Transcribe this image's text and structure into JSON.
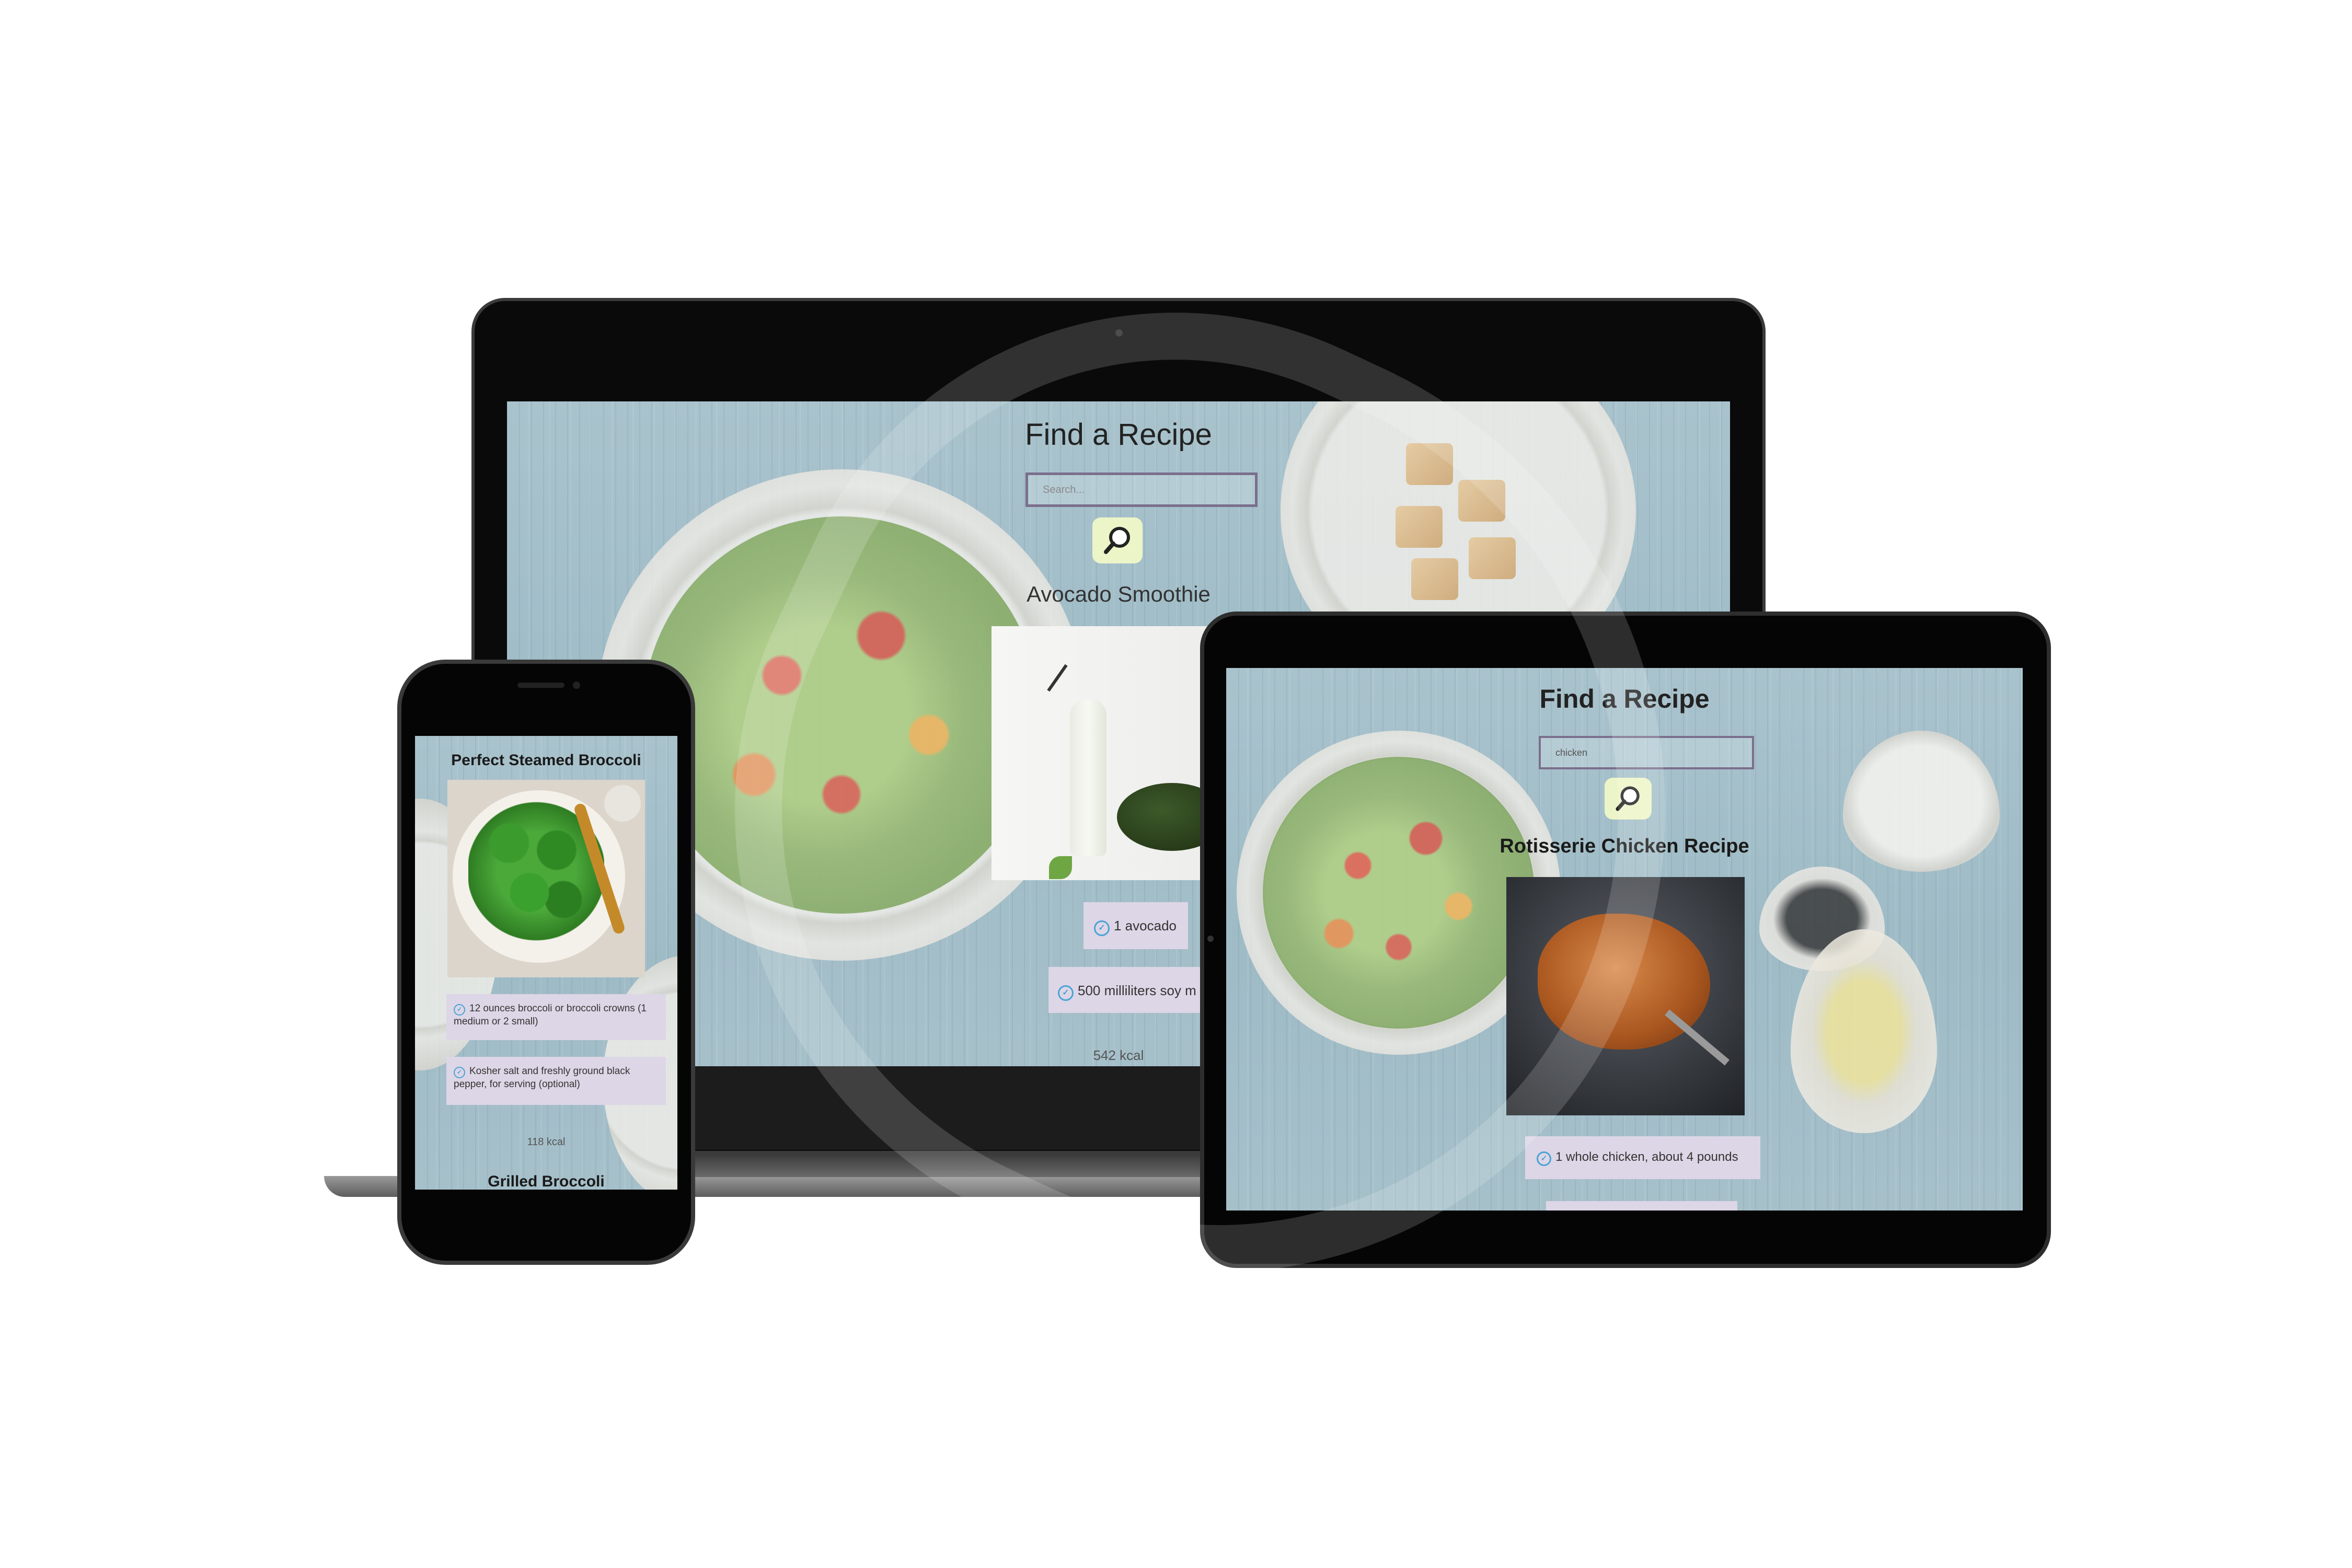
{
  "laptop": {
    "app_title": "Find a Recipe",
    "search": {
      "value": "",
      "placeholder": "Search..."
    },
    "search_icon": "magnifier-icon",
    "recipe": {
      "name": "Avocado Smoothie",
      "ingredients": [
        "1 avocado",
        "500 milliliters soy m"
      ],
      "calories": "542 kcal"
    }
  },
  "tablet": {
    "app_title": "Find a Recipe",
    "search": {
      "value": "chicken",
      "placeholder": ""
    },
    "search_icon": "magnifier-icon",
    "recipe": {
      "name": "Rotisserie Chicken Recipe",
      "ingredients": [
        "1 whole chicken, about 4 pounds"
      ]
    }
  },
  "phone": {
    "recipe": {
      "name": "Perfect Steamed Broccoli",
      "ingredients": [
        "12 ounces broccoli or broccoli crowns (1 medium or 2 small)",
        "Kosher salt and freshly ground black pepper, for serving (optional)"
      ],
      "calories": "118 kcal"
    },
    "next_recipe": {
      "name": "Grilled Broccoli"
    }
  },
  "colors": {
    "background": "#ffffff",
    "device_bezel": "#050505",
    "screen_wood": "#a3bec8",
    "search_border": "#7a6f8c",
    "search_button": "#ecf5c8",
    "ingredient_chip": "#ddd6e6",
    "check_icon": "#4ba3d6"
  }
}
